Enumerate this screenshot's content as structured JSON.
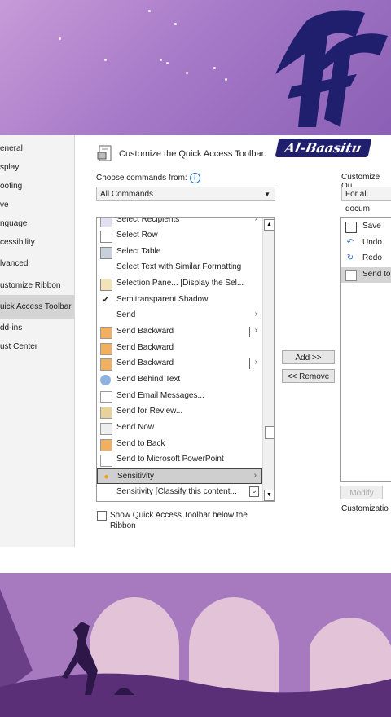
{
  "brand": {
    "logo_text": "Al-Baasitu"
  },
  "nav": {
    "items": [
      "eneral",
      "splay",
      "oofing",
      "ve",
      "nguage",
      "cessibility",
      "lvanced",
      "ustomize Ribbon",
      "uick Access Toolbar",
      "dd-ins",
      "ust Center"
    ],
    "selected_index": 8
  },
  "panel": {
    "title": "Customize the Quick Access Toolbar.",
    "choose_label": "Choose commands from:",
    "choose_value": "All Commands",
    "customize_label": "Customize Qu",
    "customize_value": "For all docum",
    "show_below_label_1": "Show Quick Access Toolbar below the",
    "show_below_label_2": "Ribbon",
    "add_button": "Add >>",
    "remove_button": "<< Remove",
    "modify_button": "Modify",
    "customizations_label": "Customizatio",
    "info_icon": "info-icon"
  },
  "commands": [
    {
      "label": "Select Recipients",
      "icon": "recipients-icon",
      "sub": "›"
    },
    {
      "label": "Select Row",
      "icon": "row-icon",
      "sub": ""
    },
    {
      "label": "Select Table",
      "icon": "table-icon",
      "sub": ""
    },
    {
      "label": "Select Text with Similar Formatting",
      "icon": "",
      "sub": ""
    },
    {
      "label": "Selection Pane... [Display the Sel...",
      "icon": "selection-pane-icon",
      "sub": ""
    },
    {
      "label": "Semitransparent Shadow",
      "icon": "checkmark-icon",
      "sub": ""
    },
    {
      "label": "Send",
      "icon": "",
      "sub": "›"
    },
    {
      "label": "Send Backward",
      "icon": "send-backward-icon",
      "sub": "›",
      "split": true
    },
    {
      "label": "Send Backward",
      "icon": "send-backward-icon",
      "sub": ""
    },
    {
      "label": "Send Backward",
      "icon": "send-backward-icon",
      "sub": "›",
      "split": true
    },
    {
      "label": "Send Behind Text",
      "icon": "behind-text-icon",
      "sub": ""
    },
    {
      "label": "Send Email Messages...",
      "icon": "email-icon",
      "sub": ""
    },
    {
      "label": "Send for Review...",
      "icon": "review-icon",
      "sub": ""
    },
    {
      "label": "Send Now",
      "icon": "send-now-icon",
      "sub": ""
    },
    {
      "label": "Send to Back",
      "icon": "send-to-back-icon",
      "sub": ""
    },
    {
      "label": "Send to Microsoft PowerPoint",
      "icon": "powerpoint-icon",
      "sub": ""
    },
    {
      "label": "Sensitivity",
      "icon": "sensitivity-icon",
      "sub": "›",
      "selected": true
    },
    {
      "label": "Sensitivity [Classify this content...",
      "icon": "",
      "sub": "⌄"
    }
  ],
  "toolbar_items": [
    {
      "label": "Save",
      "icon": "save-icon"
    },
    {
      "label": "Undo",
      "icon": "undo-icon"
    },
    {
      "label": "Redo",
      "icon": "redo-icon"
    },
    {
      "label": "Send to",
      "icon": "send-to-icon",
      "selected": true
    }
  ],
  "colors": {
    "accent": "#1f1f6e",
    "selected": "#d4d4d4",
    "purple_bg": "#a77ac8"
  }
}
